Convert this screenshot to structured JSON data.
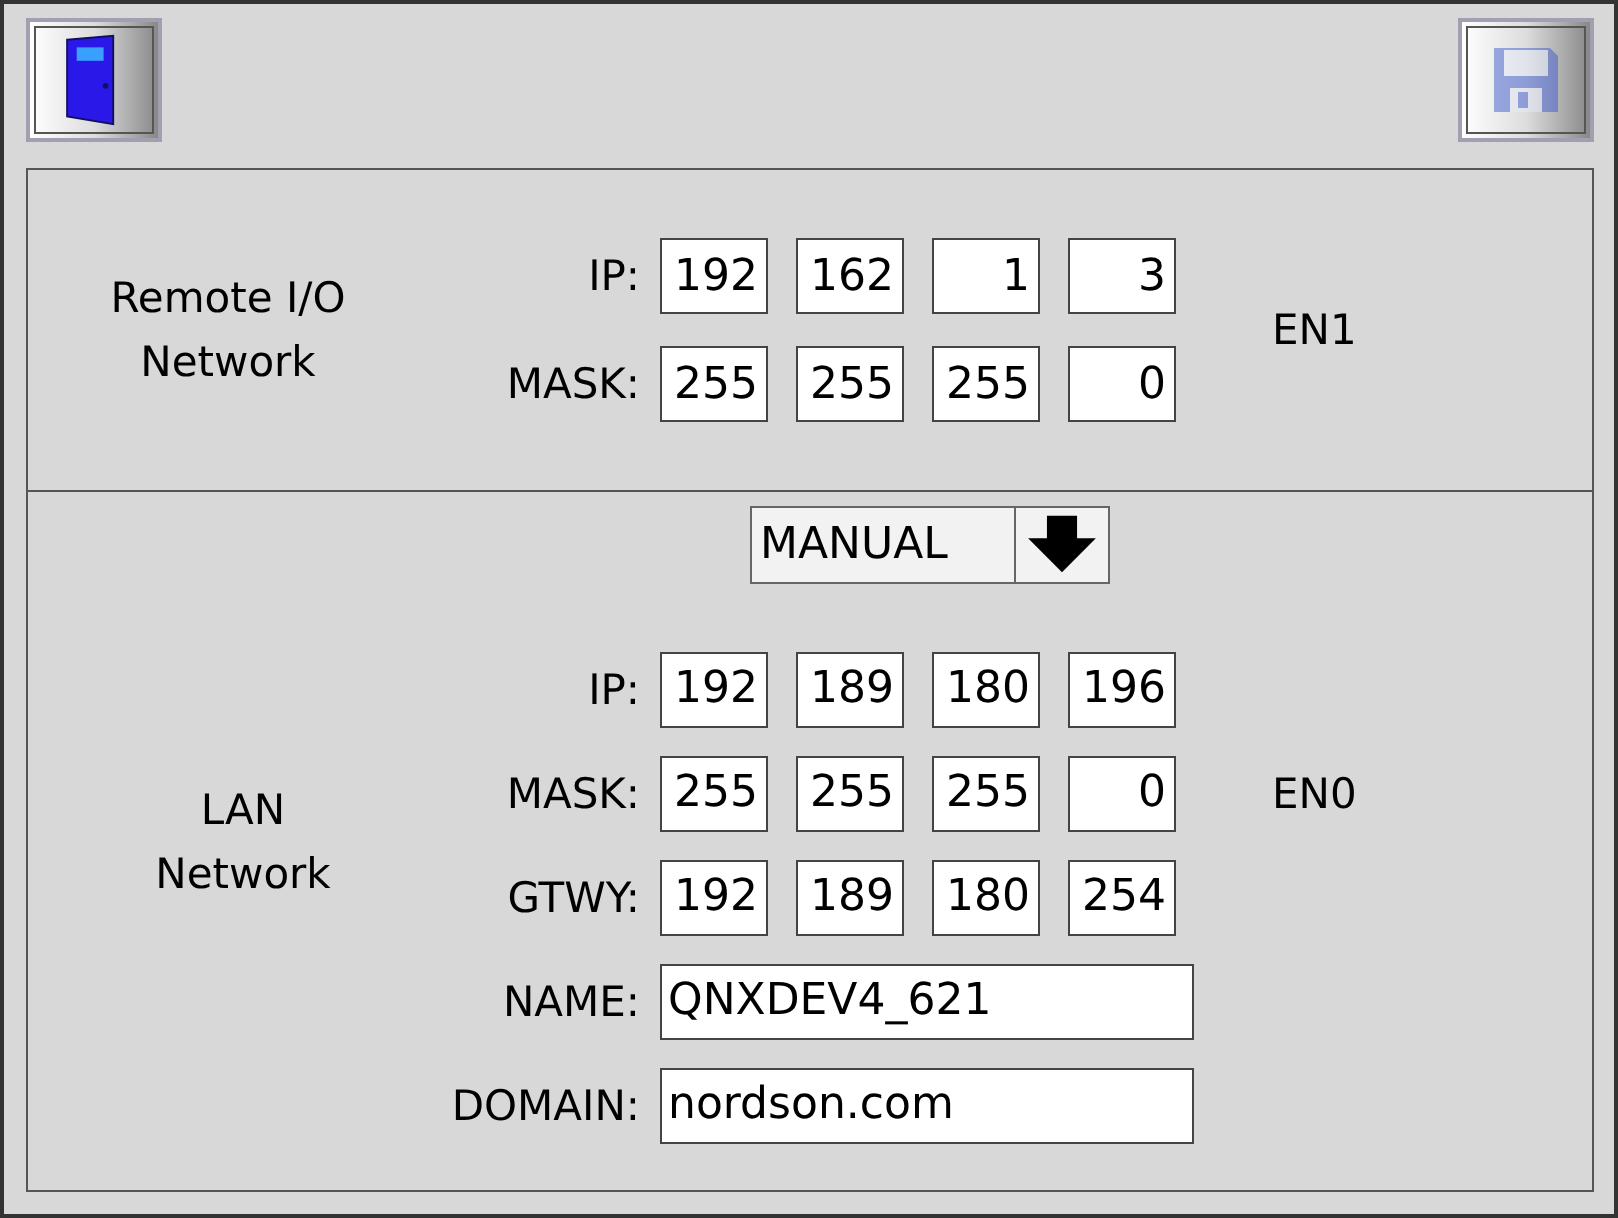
{
  "toolbar": {
    "exit_button": {
      "disabled": false
    },
    "save_button": {
      "disabled": true
    }
  },
  "sections": [
    {
      "title": "Remote I/O\nNetwork",
      "port": "EN1",
      "addresses": [
        {
          "label": "IP:",
          "octets": [
            "192",
            "162",
            "1",
            "3"
          ]
        },
        {
          "label": "MASK:",
          "octets": [
            "255",
            "255",
            "255",
            "0"
          ]
        }
      ]
    },
    {
      "title": "LAN\nNetwork",
      "port": "EN0",
      "mode_dropdown": {
        "value": "MANUAL"
      },
      "addresses": [
        {
          "label": "IP:",
          "octets": [
            "192",
            "189",
            "180",
            "196"
          ]
        },
        {
          "label": "MASK:",
          "octets": [
            "255",
            "255",
            "255",
            "0"
          ]
        },
        {
          "label": "GTWY:",
          "octets": [
            "192",
            "189",
            "180",
            "254"
          ]
        }
      ],
      "text_fields": [
        {
          "label": "NAME:",
          "value": "QNXDEV4_621"
        },
        {
          "label": "DOMAIN:",
          "value": "nordson.com"
        }
      ]
    }
  ]
}
